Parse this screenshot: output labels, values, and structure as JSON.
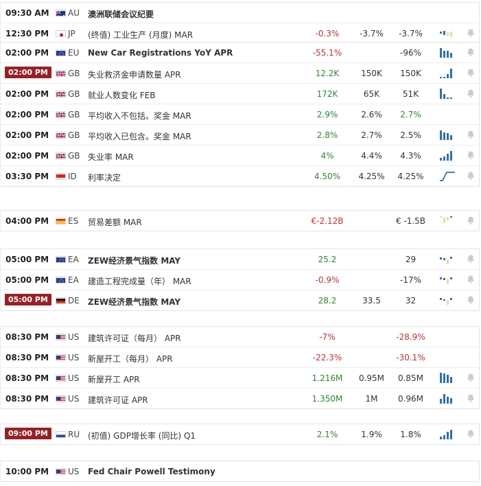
{
  "colors": {
    "positive": "#2a8a2a",
    "negative": "#c8302c",
    "time_highlight_bg": "#9a1f24",
    "spark_bar": "#2f6fb1",
    "spark_bar_light": "#f1d9a0",
    "bell": "#cccccc"
  },
  "groups": [
    {
      "rows": [
        {
          "time": "09:30 AM",
          "highlight": false,
          "flag": "au",
          "country": "AU",
          "event": "澳洲联储会议纪要",
          "bold": true,
          "actual": "",
          "actual_color": "",
          "forecast": "",
          "previous": "",
          "previous_color": "",
          "spark": "none",
          "bell": false
        },
        {
          "time": "12:30 PM",
          "highlight": false,
          "flag": "jp",
          "country": "JP",
          "event": "(终值) 工业生产 (月度) MAR",
          "bold": false,
          "actual": "-0.3%",
          "actual_color": "red",
          "forecast": "-3.7%",
          "previous": "-3.7%",
          "previous_color": "dark",
          "spark": "s1",
          "bell": true
        }
      ]
    },
    {
      "rows": [
        {
          "time": "02:00 PM",
          "highlight": false,
          "flag": "eu",
          "country": "EU",
          "event": "New Car Registrations YoY APR",
          "bold": true,
          "actual": "-55.1%",
          "actual_color": "red",
          "forecast": "",
          "previous": "-96%",
          "previous_color": "dark",
          "spark": "s2",
          "bell": true
        },
        {
          "time": "02:00 PM",
          "highlight": true,
          "flag": "gb",
          "country": "GB",
          "event": "失业救济金申请数量 APR",
          "bold": false,
          "actual": "12.2K",
          "actual_color": "green",
          "forecast": "150K",
          "previous": "150K",
          "previous_color": "dark",
          "spark": "s3",
          "bell": true
        },
        {
          "time": "02:00 PM",
          "highlight": false,
          "flag": "gb",
          "country": "GB",
          "event": "就业人数变化 FEB",
          "bold": false,
          "actual": "172K",
          "actual_color": "green",
          "forecast": "65K",
          "previous": "51K",
          "previous_color": "dark",
          "spark": "s4",
          "bell": true
        },
        {
          "time": "02:00 PM",
          "highlight": false,
          "flag": "gb",
          "country": "GB",
          "event": "平均收入不包括。奖金 MAR",
          "bold": false,
          "actual": "2.9%",
          "actual_color": "green",
          "forecast": "2.6%",
          "previous": "2.7%",
          "previous_color": "green",
          "spark": "none",
          "bell": false
        },
        {
          "time": "02:00 PM",
          "highlight": false,
          "flag": "gb",
          "country": "GB",
          "event": "平均收入已包含。奖金 MAR",
          "bold": false,
          "actual": "2.8%",
          "actual_color": "green",
          "forecast": "2.7%",
          "previous": "2.5%",
          "previous_color": "dark",
          "spark": "s5",
          "bell": true
        },
        {
          "time": "02:00 PM",
          "highlight": false,
          "flag": "gb",
          "country": "GB",
          "event": "失业率 MAR",
          "bold": false,
          "actual": "4%",
          "actual_color": "green",
          "forecast": "4.4%",
          "previous": "4.3%",
          "previous_color": "dark",
          "spark": "s6",
          "bell": true
        },
        {
          "time": "03:30 PM",
          "highlight": false,
          "flag": "id",
          "country": "ID",
          "event": "利率决定",
          "bold": false,
          "actual": "4.50%",
          "actual_color": "green",
          "forecast": "4.25%",
          "previous": "4.25%",
          "previous_color": "dark",
          "spark": "line",
          "bell": true
        }
      ]
    },
    {
      "rows": [
        {
          "time": "04:00 PM",
          "highlight": false,
          "flag": "es",
          "country": "ES",
          "event": "贸易差额 MAR",
          "bold": false,
          "actual": "€-2.12B",
          "actual_color": "red",
          "forecast": "",
          "previous": "€ -1.5B",
          "previous_color": "dark",
          "spark": "s7",
          "bell": true
        }
      ]
    },
    {
      "rows": [
        {
          "time": "05:00 PM",
          "highlight": false,
          "flag": "eu",
          "country": "EA",
          "event": "ZEW经济景气指数 MAY",
          "bold": true,
          "actual": "25.2",
          "actual_color": "green",
          "forecast": "",
          "previous": "29",
          "previous_color": "dark",
          "spark": "s8",
          "bell": true
        },
        {
          "time": "05:00 PM",
          "highlight": false,
          "flag": "eu",
          "country": "EA",
          "event": "建造工程完成量（年） MAR",
          "bold": false,
          "actual": "-0.9%",
          "actual_color": "red",
          "forecast": "",
          "previous": "-17%",
          "previous_color": "dark",
          "spark": "s9",
          "bell": true
        },
        {
          "time": "05:00 PM",
          "highlight": true,
          "flag": "de",
          "country": "DE",
          "event": "ZEW经济景气指数 MAY",
          "bold": true,
          "actual": "28.2",
          "actual_color": "green",
          "forecast": "33.5",
          "previous": "32",
          "previous_color": "dark",
          "spark": "s10",
          "bell": true
        }
      ]
    },
    {
      "rows": [
        {
          "time": "08:30 PM",
          "highlight": false,
          "flag": "us",
          "country": "US",
          "event": "建筑许可证（每月） APR",
          "bold": false,
          "actual": "-7%",
          "actual_color": "red",
          "forecast": "",
          "previous": "-28.9%",
          "previous_color": "red",
          "spark": "none",
          "bell": false
        },
        {
          "time": "08:30 PM",
          "highlight": false,
          "flag": "us",
          "country": "US",
          "event": "新屋开工（每月） APR",
          "bold": false,
          "actual": "-22.3%",
          "actual_color": "red",
          "forecast": "",
          "previous": "-30.1%",
          "previous_color": "red",
          "spark": "none",
          "bell": false
        },
        {
          "time": "08:30 PM",
          "highlight": false,
          "flag": "us",
          "country": "US",
          "event": "新屋开工 APR",
          "bold": false,
          "actual": "1.216M",
          "actual_color": "green",
          "forecast": "0.95M",
          "previous": "0.85M",
          "previous_color": "dark",
          "spark": "s11",
          "bell": true
        },
        {
          "time": "08:30 PM",
          "highlight": false,
          "flag": "us",
          "country": "US",
          "event": "建筑许可证 APR",
          "bold": false,
          "actual": "1.350M",
          "actual_color": "green",
          "forecast": "1M",
          "previous": "0.96M",
          "previous_color": "dark",
          "spark": "s12",
          "bell": true
        }
      ]
    },
    {
      "rows": [
        {
          "time": "09:00 PM",
          "highlight": true,
          "flag": "ru",
          "country": "RU",
          "event": "(初值) GDP增长率 (同比) Q1",
          "bold": false,
          "actual": "2.1%",
          "actual_color": "green",
          "forecast": "1.9%",
          "previous": "1.8%",
          "previous_color": "dark",
          "spark": "s13",
          "bell": true
        }
      ]
    },
    {
      "rows": [
        {
          "time": "10:00 PM",
          "highlight": false,
          "flag": "us",
          "country": "US",
          "event": "Fed Chair Powell Testimony",
          "bold": true,
          "actual": "",
          "actual_color": "",
          "forecast": "",
          "previous": "",
          "previous_color": "",
          "spark": "none",
          "bell": false
        }
      ]
    }
  ],
  "sparklines": {
    "s1": [
      {
        "level": 0.2,
        "tone": "b",
        "pos": 0.5
      },
      {
        "level": 0.35,
        "tone": "b",
        "pos": 0.5
      },
      {
        "level": 0.3,
        "tone": "y",
        "pos": 0.4
      },
      {
        "level": 0.5,
        "tone": "y",
        "pos": 0.3
      }
    ],
    "s2": [
      {
        "level": 0.85,
        "tone": "b",
        "pos": 0
      },
      {
        "level": 0.65,
        "tone": "b",
        "pos": 0
      },
      {
        "level": 0.65,
        "tone": "b",
        "pos": 0
      },
      {
        "level": 0.45,
        "tone": "b",
        "pos": 0
      }
    ],
    "s3": [
      {
        "level": 0.12,
        "tone": "b",
        "pos": 0
      },
      {
        "level": 0.12,
        "tone": "b",
        "pos": 0
      },
      {
        "level": 0.35,
        "tone": "b",
        "pos": 0
      },
      {
        "level": 0.9,
        "tone": "b",
        "pos": 0
      }
    ],
    "s4": [
      {
        "level": 0.95,
        "tone": "b",
        "pos": 0
      },
      {
        "level": 0.45,
        "tone": "b",
        "pos": 0
      },
      {
        "level": 0.15,
        "tone": "b",
        "pos": 0
      },
      {
        "level": 0.15,
        "tone": "b",
        "pos": 0
      }
    ],
    "s5": [
      {
        "level": 0.85,
        "tone": "b",
        "pos": 0
      },
      {
        "level": 0.7,
        "tone": "b",
        "pos": 0
      },
      {
        "level": 0.6,
        "tone": "b",
        "pos": 0
      },
      {
        "level": 0.45,
        "tone": "b",
        "pos": 0
      }
    ],
    "s6": [
      {
        "level": 0.25,
        "tone": "b",
        "pos": 0
      },
      {
        "level": 0.4,
        "tone": "b",
        "pos": 0
      },
      {
        "level": 0.6,
        "tone": "b",
        "pos": 0
      },
      {
        "level": 0.9,
        "tone": "b",
        "pos": 0
      }
    ],
    "s7": [
      {
        "level": 0.15,
        "tone": "y",
        "pos": 0.85
      },
      {
        "level": 0.5,
        "tone": "y",
        "pos": 0.5
      },
      {
        "level": 0.3,
        "tone": "y",
        "pos": 0.7
      },
      {
        "level": 0.15,
        "tone": "b",
        "pos": 0.85
      }
    ],
    "s8": [
      {
        "level": 0.2,
        "tone": "b",
        "pos": 0.5
      },
      {
        "level": 0.2,
        "tone": "b",
        "pos": 0.45
      },
      {
        "level": 0.45,
        "tone": "y",
        "pos": 0.05
      },
      {
        "level": 0.2,
        "tone": "b",
        "pos": 0.6
      }
    ],
    "s9": [
      {
        "level": 0.2,
        "tone": "b",
        "pos": 0.6
      },
      {
        "level": 0.2,
        "tone": "b",
        "pos": 0.55
      },
      {
        "level": 0.45,
        "tone": "y",
        "pos": 0.1
      },
      {
        "level": 0.2,
        "tone": "b",
        "pos": 0.6
      }
    ],
    "s10": [
      {
        "level": 0.2,
        "tone": "b",
        "pos": 0.6
      },
      {
        "level": 0.15,
        "tone": "b",
        "pos": 0.5
      },
      {
        "level": 0.45,
        "tone": "y",
        "pos": 0.1
      },
      {
        "level": 0.2,
        "tone": "b",
        "pos": 0.6
      }
    ],
    "s11": [
      {
        "level": 0.95,
        "tone": "b",
        "pos": 0
      },
      {
        "level": 0.9,
        "tone": "b",
        "pos": 0
      },
      {
        "level": 0.75,
        "tone": "b",
        "pos": 0
      },
      {
        "level": 0.55,
        "tone": "b",
        "pos": 0
      }
    ],
    "s12": [
      {
        "level": 0.45,
        "tone": "b",
        "pos": 0
      },
      {
        "level": 0.85,
        "tone": "b",
        "pos": 0
      },
      {
        "level": 0.6,
        "tone": "b",
        "pos": 0
      },
      {
        "level": 0.5,
        "tone": "b",
        "pos": 0
      }
    ],
    "s13": [
      {
        "level": 0.25,
        "tone": "b",
        "pos": 0
      },
      {
        "level": 0.4,
        "tone": "b",
        "pos": 0
      },
      {
        "level": 0.7,
        "tone": "b",
        "pos": 0
      },
      {
        "level": 0.9,
        "tone": "b",
        "pos": 0
      }
    ]
  }
}
